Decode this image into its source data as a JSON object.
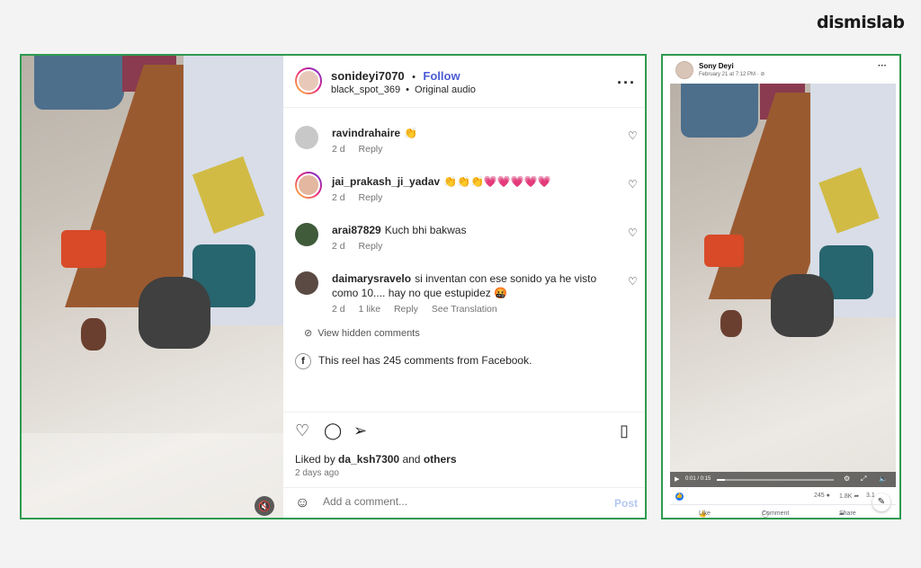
{
  "brand": "dismislab",
  "instagram": {
    "username": "sonideyi7070",
    "separator": "•",
    "follow_label": "Follow",
    "audio_user": "black_spot_369",
    "audio_label": "Original audio",
    "more_icon": "more-horizontal-icon",
    "comments": [
      {
        "user": "ravindrahaire",
        "text": "👏",
        "age": "2 d",
        "likes": "",
        "reply": "Reply",
        "translate": "",
        "avatar_color": "#c8c8c8"
      },
      {
        "user": "jai_prakash_ji_yadav",
        "text": "👏👏👏💗💗💗💗💗",
        "age": "2 d",
        "likes": "",
        "reply": "Reply",
        "translate": "",
        "avatar_color": "#e3b7a0"
      },
      {
        "user": "arai87829",
        "text": "Kuch bhi bakwas",
        "age": "2 d",
        "likes": "",
        "reply": "Reply",
        "translate": "",
        "avatar_color": "#3f5b3a"
      },
      {
        "user": "daimarysravelo",
        "text": "si inventan con ese sonido ya he visto como 10.... hay no que estupidez 🤬",
        "age": "2 d",
        "likes": "1 like",
        "reply": "Reply",
        "translate": "See Translation",
        "avatar_color": "#5b4a44"
      }
    ],
    "view_hidden": "View hidden comments",
    "fb_note": "This reel has 245 comments from Facebook.",
    "liked_prefix": "Liked by",
    "liked_user": "da_ksh7300",
    "liked_and": "and",
    "liked_others": "others",
    "time_ago": "2 days ago",
    "comment_placeholder": "Add a comment...",
    "post_label": "Post"
  },
  "facebook": {
    "name": "Sony Deyi",
    "date": "February 21 at 7:12 PM · ⊘",
    "time": "0:01 / 0:15",
    "progress": 0.07,
    "comments_count": "245",
    "shares_count": "1.8K",
    "views_count": "3.1",
    "like_label": "Like",
    "comment_label": "Comment",
    "share_label": "Share"
  }
}
